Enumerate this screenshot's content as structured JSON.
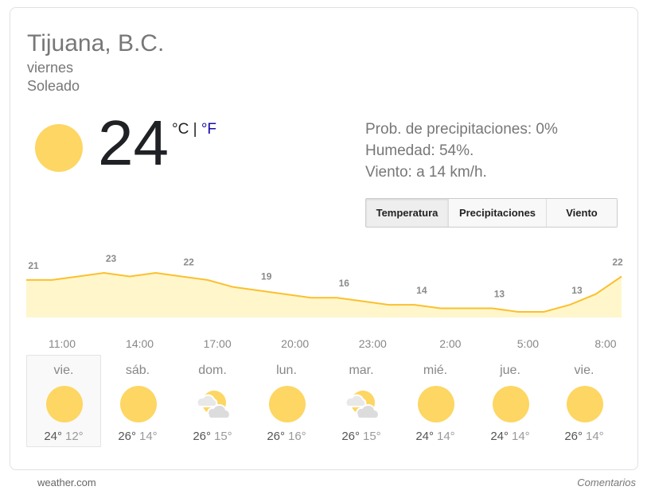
{
  "header": {
    "location": "Tijuana, B.C.",
    "day": "viernes",
    "condition": "Soleado"
  },
  "current": {
    "temperature": "24",
    "icon": "sun-icon",
    "unit_c": "°C",
    "unit_sep": "|",
    "unit_f": "°F"
  },
  "details": {
    "precipitation": "Prob. de precipitaciones: 0%",
    "humidity": "Humedad: 54%.",
    "wind": "Viento: a 14 km/h."
  },
  "tabs": [
    {
      "label": "Temperatura",
      "active": true
    },
    {
      "label": "Precipitaciones",
      "active": false
    },
    {
      "label": "Viento",
      "active": false
    }
  ],
  "colors": {
    "sun": "#fdd663",
    "line": "#fbc02d",
    "fill": "#fff6cc",
    "link": "#1a0dab"
  },
  "chart_data": {
    "type": "area",
    "x": [
      "11:00",
      "12:00",
      "13:00",
      "14:00",
      "15:00",
      "16:00",
      "17:00",
      "18:00",
      "19:00",
      "20:00",
      "21:00",
      "22:00",
      "23:00",
      "0:00",
      "1:00",
      "2:00",
      "3:00",
      "4:00",
      "5:00",
      "6:00",
      "7:00",
      "8:00",
      "9:00",
      "10:00"
    ],
    "values": [
      21,
      21,
      22,
      23,
      22,
      23,
      22,
      21,
      19,
      18,
      17,
      16,
      16,
      15,
      14,
      14,
      13,
      13,
      13,
      12,
      12,
      14,
      17,
      22
    ],
    "point_labels": [
      {
        "index": 0,
        "label": "21"
      },
      {
        "index": 3,
        "label": "23"
      },
      {
        "index": 6,
        "label": "22"
      },
      {
        "index": 9,
        "label": "19"
      },
      {
        "index": 12,
        "label": "16"
      },
      {
        "index": 15,
        "label": "14"
      },
      {
        "index": 18,
        "label": "13"
      },
      {
        "index": 21,
        "label": "13"
      },
      {
        "index": 23,
        "label": "22"
      }
    ],
    "tick_labels": [
      "11:00",
      "14:00",
      "17:00",
      "20:00",
      "23:00",
      "2:00",
      "5:00",
      "8:00"
    ],
    "ylim": [
      12,
      23
    ],
    "grid": false
  },
  "forecast": [
    {
      "day": "vie.",
      "icon": "sun-icon",
      "high": "24°",
      "low": "12°",
      "selected": true
    },
    {
      "day": "sáb.",
      "icon": "sun-icon",
      "high": "26°",
      "low": "14°",
      "selected": false
    },
    {
      "day": "dom.",
      "icon": "partly-cloudy-icon",
      "high": "26°",
      "low": "15°",
      "selected": false
    },
    {
      "day": "lun.",
      "icon": "sun-icon",
      "high": "26°",
      "low": "16°",
      "selected": false
    },
    {
      "day": "mar.",
      "icon": "partly-cloudy-icon",
      "high": "26°",
      "low": "15°",
      "selected": false
    },
    {
      "day": "mié.",
      "icon": "sun-icon",
      "high": "24°",
      "low": "14°",
      "selected": false
    },
    {
      "day": "jue.",
      "icon": "sun-icon",
      "high": "24°",
      "low": "14°",
      "selected": false
    },
    {
      "day": "vie.",
      "icon": "sun-icon",
      "high": "26°",
      "low": "14°",
      "selected": false
    }
  ],
  "footer": {
    "source": "weather.com",
    "feedback": "Comentarios"
  }
}
